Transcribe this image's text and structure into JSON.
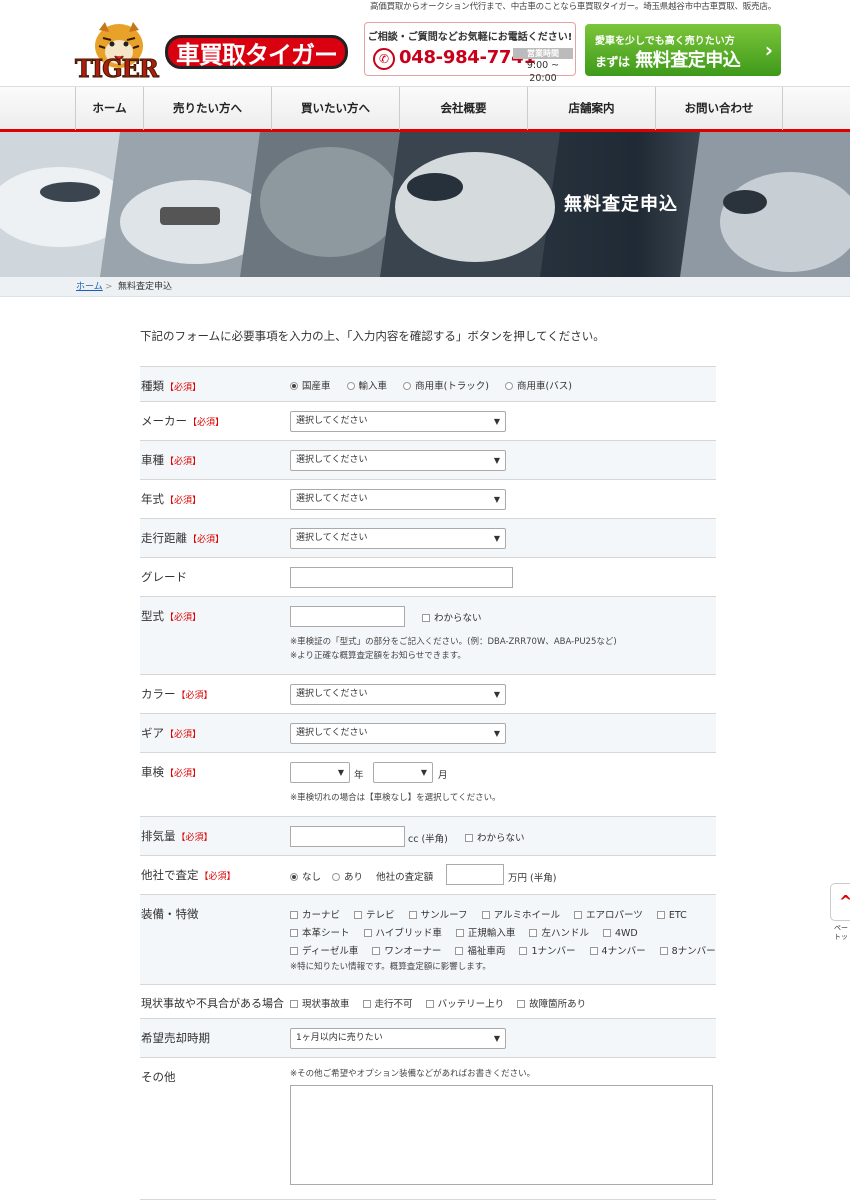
{
  "header": {
    "tagline": "高価買取からオークション代行まで、中古車のことなら車買取タイガー。埼玉県越谷市中古車買取、販売店。",
    "logo_text": "車買取タイガー",
    "logo_en": "TIGER",
    "phone_ask": "ご相談・ご質問などお気軽にお電話ください!",
    "phone_number": "048-984-7741",
    "hours_label": "営業時間",
    "hours_value": "9:00 ~ 20:00",
    "cta_line1": "愛車を少しでも高く売りたい方",
    "cta_pre": "まずは",
    "cta_main": "無料査定申込"
  },
  "nav": [
    "ホーム",
    "売りたい方へ",
    "買いたい方へ",
    "会社概要",
    "店舗案内",
    "お問い合わせ"
  ],
  "hero_title": "無料査定申込",
  "breadcrumb": {
    "home": "ホーム",
    "sep": ">",
    "current": "無料査定申込"
  },
  "intro": "下記のフォームに必要事項を入力の上、「入力内容を確認する」ボタンを押してください。",
  "required": "【必須】",
  "select_placeholder": "選択してください",
  "form": {
    "type_label": "種類",
    "type_options": [
      "国産車",
      "輸入車",
      "商用車(トラック)",
      "商用車(バス)"
    ],
    "maker_label": "メーカー",
    "model_label": "車種",
    "year_label": "年式",
    "mileage_label": "走行距離",
    "grade_label": "グレード",
    "katashiki_label": "型式",
    "katashiki_unknown": "わからない",
    "katashiki_note1": "※車検証の「型式」の部分をご記入ください。(例：DBA-ZRR70W、ABA-PU25など)",
    "katashiki_note2": "※より正確な概算査定額をお知らせできます。",
    "color_label": "カラー",
    "gear_label": "ギア",
    "shaken_label": "車検",
    "shaken_year": "年",
    "shaken_month": "月",
    "shaken_note": "※車検切れの場合は【車検なし】を選択してください。",
    "displacement_label": "排気量",
    "displacement_unit": "cc (半角)",
    "displacement_unknown": "わからない",
    "other_label": "他社で査定",
    "other_options": [
      "なし",
      "あり"
    ],
    "other_price_label": "他社の査定額",
    "other_price_unit": "万円 (半角)",
    "equip_label": "装備・特徴",
    "equip_rows": [
      [
        "カーナビ",
        "テレビ",
        "サンルーフ",
        "アルミホイール",
        "エアロパーツ",
        "ETC"
      ],
      [
        "本革シート",
        "ハイブリッド車",
        "正規輸入車",
        "左ハンドル",
        "4WD"
      ],
      [
        "ディーゼル車",
        "ワンオーナー",
        "福祉車両",
        "1ナンバー",
        "4ナンバー",
        "8ナンバー"
      ]
    ],
    "equip_note": "※特に知りたい情報です。概算査定額に影響します。",
    "accident_label": "現状事故や不具合がある場合",
    "accident_options": [
      "現状事故車",
      "走行不可",
      "バッテリー上り",
      "故障箇所あり"
    ],
    "timing_label": "希望売却時期",
    "timing_value": "1ヶ月以内に売りたい",
    "other_text_label": "その他",
    "other_text_note": "※その他ご希望やオプション装備などがあればお書きください。"
  },
  "side": {
    "arrow": "^",
    "text1": "ペー",
    "text2": "トッ"
  }
}
